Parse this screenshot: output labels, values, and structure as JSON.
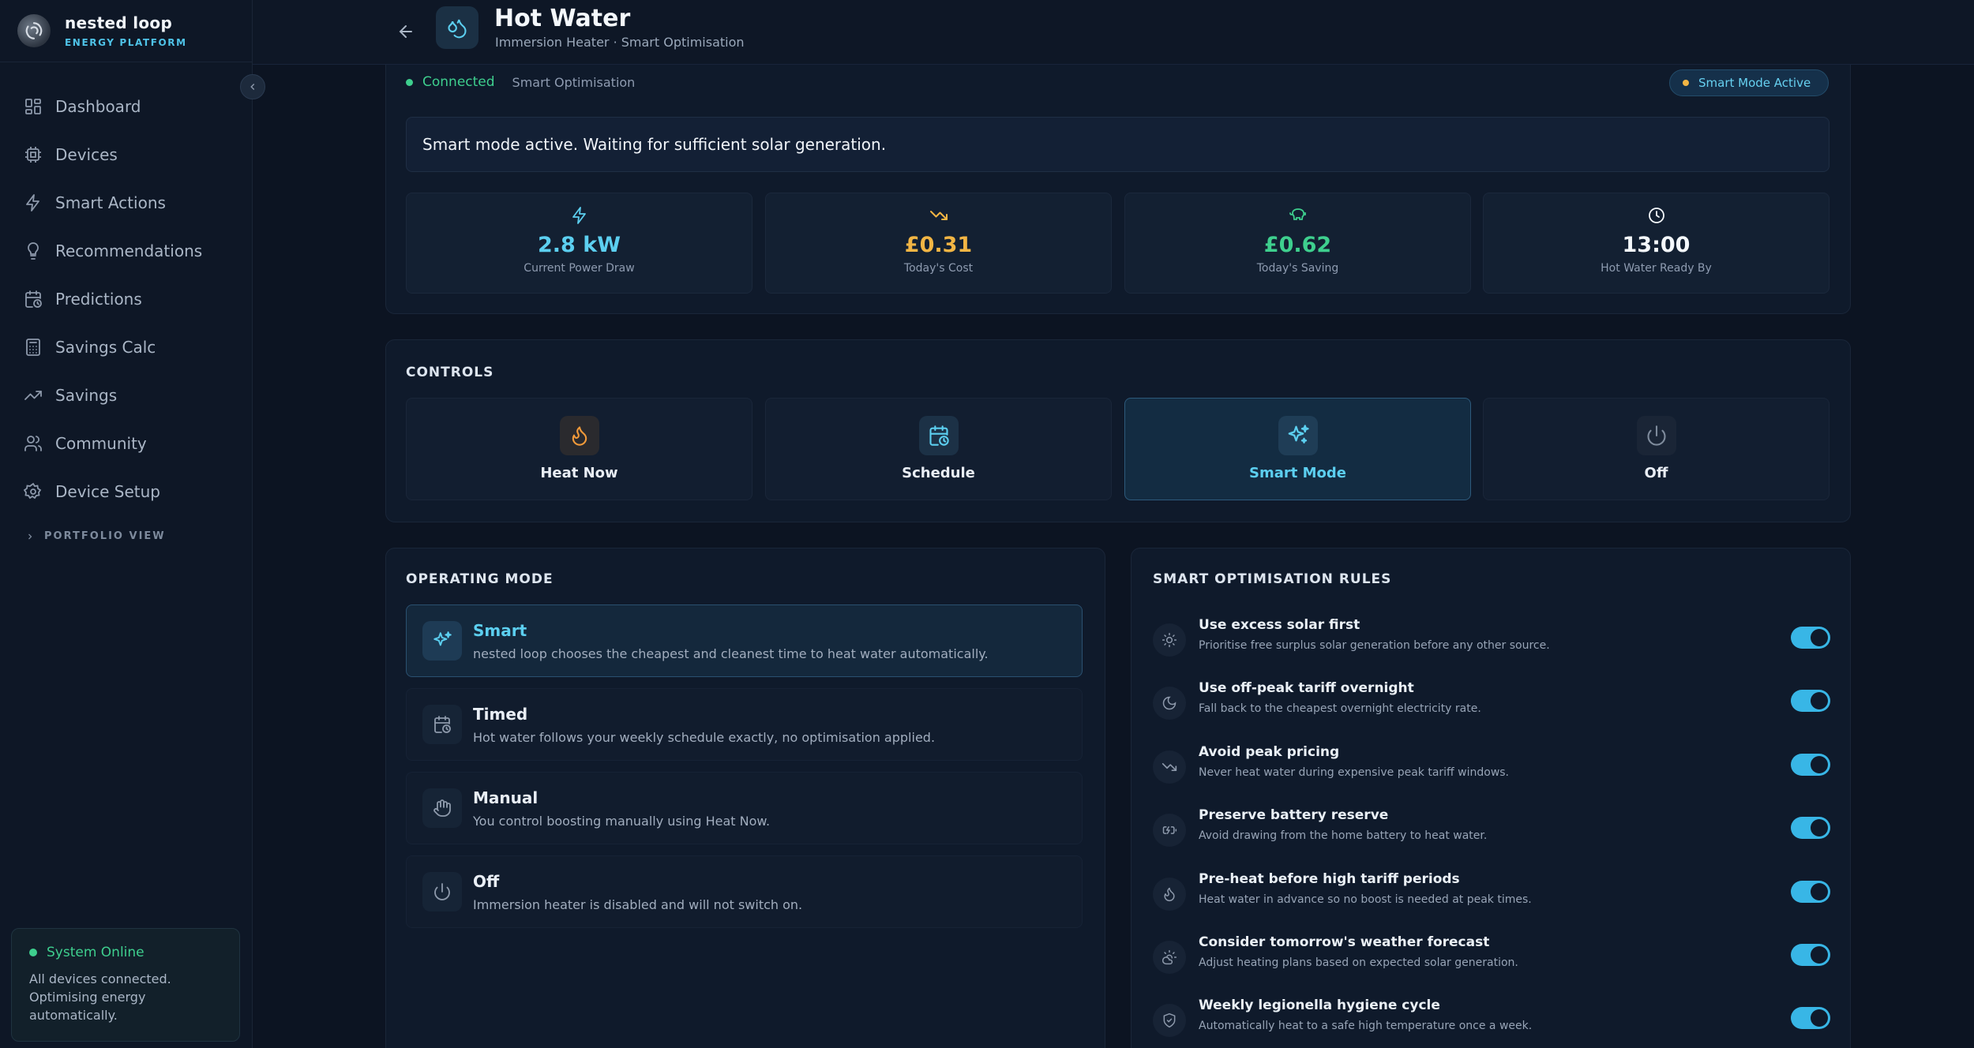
{
  "brand": {
    "name": "nested loop",
    "subtitle": "ENERGY PLATFORM"
  },
  "sidebar": {
    "items": [
      {
        "label": "Dashboard",
        "icon": "grid-icon"
      },
      {
        "label": "Devices",
        "icon": "chip-icon"
      },
      {
        "label": "Smart Actions",
        "icon": "lightning-icon"
      },
      {
        "label": "Recommendations",
        "icon": "lightbulb-icon"
      },
      {
        "label": "Predictions",
        "icon": "calendar-clock-icon"
      },
      {
        "label": "Savings Calc",
        "icon": "calculator-icon"
      },
      {
        "label": "Savings",
        "icon": "trend-up-icon"
      },
      {
        "label": "Community",
        "icon": "users-icon"
      },
      {
        "label": "Device Setup",
        "icon": "gear-icon"
      }
    ],
    "portfolio_label": "PORTFOLIO VIEW",
    "status": {
      "title": "System Online",
      "text": "All devices connected. Optimising energy automatically."
    }
  },
  "header": {
    "title": "Hot Water",
    "subtitle": "Immersion Heater · Smart Optimisation"
  },
  "status_panel": {
    "connection": "Connected",
    "connection_sub": "Smart Optimisation",
    "badge": "Smart Mode Active",
    "message": "Smart mode active. Waiting for sufficient solar generation.",
    "stats": [
      {
        "value": "2.8 kW",
        "label": "Current Power Draw",
        "color": "#5ccff0",
        "icon": "lightning-icon"
      },
      {
        "value": "£0.31",
        "label": "Today's Cost",
        "color": "#f2b544",
        "icon": "trend-down-icon"
      },
      {
        "value": "£0.62",
        "label": "Today's Saving",
        "color": "#3ecf8e",
        "icon": "piggy-bank-icon"
      },
      {
        "value": "13:00",
        "label": "Hot Water Ready By",
        "color": "#f4f8fc",
        "icon": "clock-icon"
      }
    ]
  },
  "controls": {
    "title": "CONTROLS",
    "buttons": [
      {
        "label": "Heat Now",
        "icon": "flame-icon",
        "active": false
      },
      {
        "label": "Schedule",
        "icon": "calendar-clock-icon",
        "active": false
      },
      {
        "label": "Smart Mode",
        "icon": "sparkles-icon",
        "active": true
      },
      {
        "label": "Off",
        "icon": "power-icon",
        "active": false
      }
    ]
  },
  "operating_mode": {
    "title": "OPERATING MODE",
    "modes": [
      {
        "name": "Smart",
        "desc": "nested loop chooses the cheapest and cleanest time to heat water automatically.",
        "icon": "sparkles-icon",
        "active": true
      },
      {
        "name": "Timed",
        "desc": "Hot water follows your weekly schedule exactly, no optimisation applied.",
        "icon": "calendar-clock-icon",
        "active": false
      },
      {
        "name": "Manual",
        "desc": "You control boosting manually using Heat Now.",
        "icon": "hand-icon",
        "active": false
      },
      {
        "name": "Off",
        "desc": "Immersion heater is disabled and will not switch on.",
        "icon": "power-icon",
        "active": false
      }
    ]
  },
  "rules": {
    "title": "SMART OPTIMISATION RULES",
    "items": [
      {
        "name": "Use excess solar first",
        "desc": "Prioritise free surplus solar generation before any other source.",
        "icon": "sun-icon",
        "enabled": true
      },
      {
        "name": "Use off-peak tariff overnight",
        "desc": "Fall back to the cheapest overnight electricity rate.",
        "icon": "moon-icon",
        "enabled": true
      },
      {
        "name": "Avoid peak pricing",
        "desc": "Never heat water during expensive peak tariff windows.",
        "icon": "trend-down-icon",
        "enabled": true
      },
      {
        "name": "Preserve battery reserve",
        "desc": "Avoid drawing from the home battery to heat water.",
        "icon": "battery-icon",
        "enabled": true
      },
      {
        "name": "Pre-heat before high tariff periods",
        "desc": "Heat water in advance so no boost is needed at peak times.",
        "icon": "flame-icon",
        "enabled": true
      },
      {
        "name": "Consider tomorrow's weather forecast",
        "desc": "Adjust heating plans based on expected solar generation.",
        "icon": "sun-cloud-icon",
        "enabled": true
      },
      {
        "name": "Weekly legionella hygiene cycle",
        "desc": "Automatically heat to a safe high temperature once a week.",
        "icon": "shield-check-icon",
        "enabled": true
      }
    ]
  }
}
